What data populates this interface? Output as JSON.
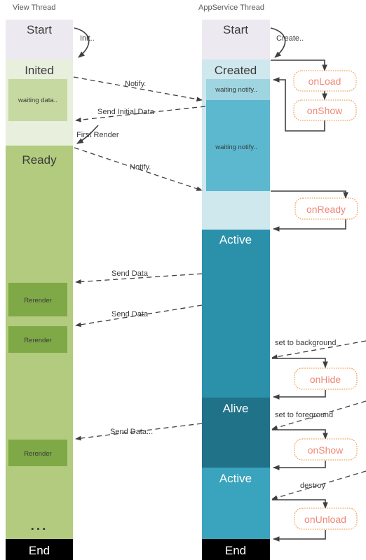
{
  "lanes": {
    "left": {
      "title": "View Thread"
    },
    "right": {
      "title": "AppService Thread"
    }
  },
  "colors": {
    "start": "#eceaf0",
    "view_inited": "#e8efdd",
    "view_waiting": "#c5d9a0",
    "view_ready": "#b2cb7f",
    "view_rerender": "#7fa847",
    "app_created": "#cfe8ee",
    "app_waiting_light": "#9ed5e0",
    "app_waiting": "#5bb8ce",
    "app_ready_gap": "#cfe8ee",
    "app_active": "#2b91ab",
    "app_alive": "#1f7287",
    "app_active2": "#3aa3bd",
    "end": "#000000",
    "hook_border": "#f0a35a",
    "hook_text": "#f08878",
    "line": "#3f3f3f"
  },
  "left_lane": {
    "states": [
      {
        "label": "Start",
        "kind": "start"
      },
      {
        "label": "Inited",
        "kind": "inited"
      },
      {
        "label": "Ready",
        "kind": "ready"
      },
      {
        "label": "End",
        "kind": "end"
      }
    ],
    "inner_boxes": [
      {
        "label": "waiting data.."
      },
      {
        "label": "Rerender"
      },
      {
        "label": "Rerender"
      },
      {
        "label": "Rerender"
      }
    ],
    "ellipsis": "..."
  },
  "right_lane": {
    "states": [
      {
        "label": "Start",
        "kind": "start"
      },
      {
        "label": "Created",
        "kind": "created"
      },
      {
        "label": "Active",
        "kind": "active"
      },
      {
        "label": "Alive",
        "kind": "alive"
      },
      {
        "label": "Active",
        "kind": "active2"
      },
      {
        "label": "End",
        "kind": "end"
      }
    ],
    "inner_boxes": [
      {
        "label": "waiting notify.."
      },
      {
        "label": "waiting notify.."
      }
    ]
  },
  "lifecycle_hooks": [
    {
      "label": "onLoad"
    },
    {
      "label": "onShow"
    },
    {
      "label": "onReady"
    },
    {
      "label": "onHide"
    },
    {
      "label": "onShow"
    },
    {
      "label": "onUnload"
    }
  ],
  "edges": [
    {
      "label": "Init..",
      "style": "solid"
    },
    {
      "label": "Create..",
      "style": "solid"
    },
    {
      "label": "Notify.",
      "style": "dashed"
    },
    {
      "label": "Send Initial Data",
      "style": "dashed"
    },
    {
      "label": "First Render",
      "style": "solid"
    },
    {
      "label": "Notify.",
      "style": "dashed"
    },
    {
      "label": "Send Data",
      "style": "dashed"
    },
    {
      "label": "Send Data",
      "style": "dashed"
    },
    {
      "label": "set to background",
      "style": "dashed"
    },
    {
      "label": "set to foreground",
      "style": "dashed"
    },
    {
      "label": "Send Data...",
      "style": "dashed"
    },
    {
      "label": "destroy",
      "style": "dashed"
    }
  ]
}
